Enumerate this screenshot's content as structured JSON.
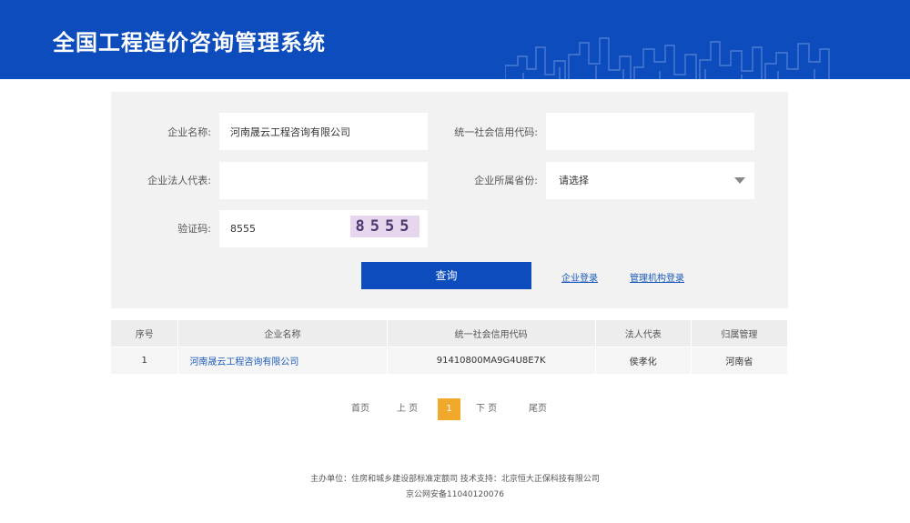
{
  "header": {
    "title": "全国工程造价咨询管理系统"
  },
  "search": {
    "company_name_label": "企业名称:",
    "company_name_value": "河南晟云工程咨询有限公司",
    "credit_code_label": "统一社会信用代码:",
    "credit_code_value": "",
    "legal_rep_label": "企业法人代表:",
    "legal_rep_value": "",
    "province_label": "企业所属省份:",
    "province_selected": "请选择",
    "captcha_label": "验证码:",
    "captcha_value": "8555",
    "captcha_image_text": "8555",
    "query_button": "查询",
    "company_login_link": "企业登录",
    "admin_login_link": "管理机构登录"
  },
  "table": {
    "headers": [
      "序号",
      "企业名称",
      "统一社会信用代码",
      "法人代表",
      "归属管理"
    ],
    "rows": [
      [
        "1",
        "河南晟云工程咨询有限公司",
        "91410800MA9G4U8E7K",
        "侯孝化",
        "河南省"
      ]
    ]
  },
  "pagination": {
    "first": "首页",
    "prev": "上 页",
    "current": "1",
    "next": "下 页",
    "last": "尾页"
  },
  "footer": {
    "line1": "主办单位：住房和城乡建设部标准定额司 技术支持：北京恒大正保科技有限公司",
    "line2": "京公网安备11040120076"
  },
  "colors": {
    "brand_blue": "#0c4cbd",
    "panel_bg": "#f2f2f2",
    "pager_active": "#f0a92b",
    "link": "#1b5bb8"
  }
}
